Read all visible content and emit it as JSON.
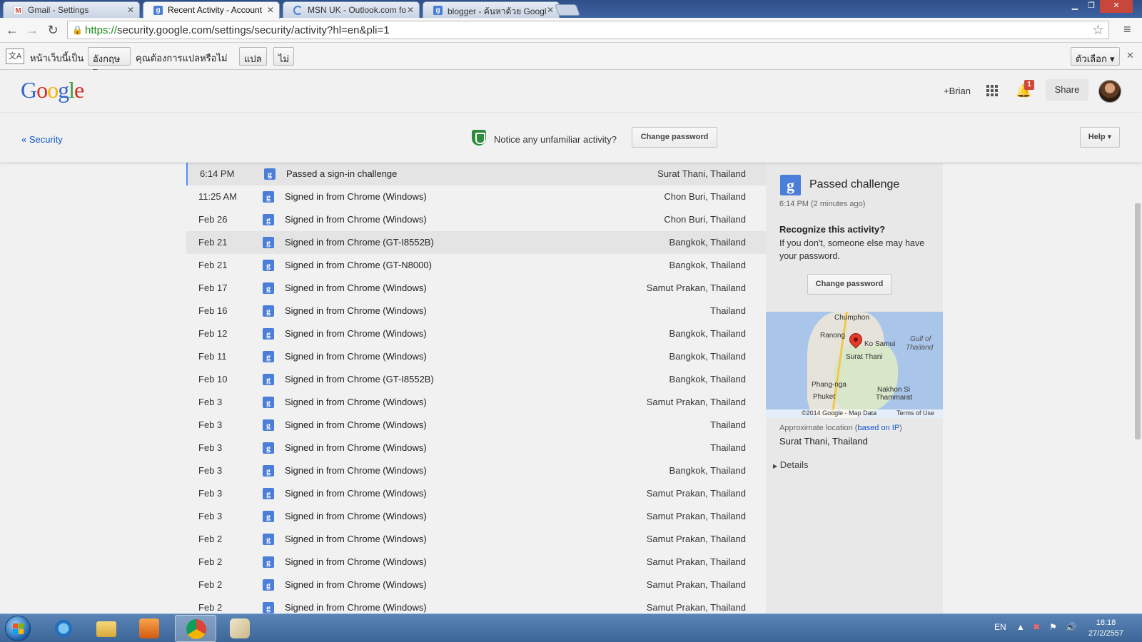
{
  "browser": {
    "tabs": [
      {
        "title": "Gmail - Settings",
        "icon": "gmail-icon",
        "active": false
      },
      {
        "title": "Recent Activity - Account",
        "icon": "google-account-icon",
        "active": true
      },
      {
        "title": "MSN UK - Outlook.com fo",
        "icon": "loading-icon",
        "active": false
      },
      {
        "title": "blogger - ค้นหาด้วย Googl",
        "icon": "google-search-icon",
        "active": false
      }
    ],
    "url_scheme": "https://",
    "url_rest": "security.google.com/settings/security/activity?hl=en&pli=1"
  },
  "translate_bar": {
    "page_is": "หน้าเว็บนี้เป็น",
    "language": "อังกฤษ",
    "question": "คุณต้องการแปลหรือไม่",
    "translate_label": "แปล",
    "no_label": "ไม่",
    "options_label": "ตัวเลือก"
  },
  "header": {
    "logo_letters": [
      "G",
      "o",
      "o",
      "g",
      "l",
      "e"
    ],
    "logo_colors": [
      "#3366cc",
      "#d62d20",
      "#f4b400",
      "#3366cc",
      "#3e9c35",
      "#d62d20"
    ],
    "user_label": "+Brian",
    "notification_count": "1",
    "share_label": "Share"
  },
  "subbar": {
    "back_label": "« Security",
    "notice": "Notice any unfamiliar activity?",
    "change_password_label": "Change password",
    "help_label": "Help"
  },
  "activity": [
    {
      "date": "6:14 PM",
      "desc": "Passed a sign-in challenge",
      "loc": "Surat Thani, Thailand",
      "state": "sel"
    },
    {
      "date": "11:25 AM",
      "desc": "Signed in from Chrome (Windows)",
      "loc": "Chon Buri, Thailand",
      "state": ""
    },
    {
      "date": "Feb 26",
      "desc": "Signed in from Chrome (Windows)",
      "loc": "Chon Buri, Thailand",
      "state": ""
    },
    {
      "date": "Feb 21",
      "desc": "Signed in from Chrome (GT-I8552B)",
      "loc": "Bangkok, Thailand",
      "state": "hover"
    },
    {
      "date": "Feb 21",
      "desc": "Signed in from Chrome (GT-N8000)",
      "loc": "Bangkok, Thailand",
      "state": ""
    },
    {
      "date": "Feb 17",
      "desc": "Signed in from Chrome (Windows)",
      "loc": "Samut Prakan, Thailand",
      "state": ""
    },
    {
      "date": "Feb 16",
      "desc": "Signed in from Chrome (Windows)",
      "loc": "Thailand",
      "state": ""
    },
    {
      "date": "Feb 12",
      "desc": "Signed in from Chrome (Windows)",
      "loc": "Bangkok, Thailand",
      "state": ""
    },
    {
      "date": "Feb 11",
      "desc": "Signed in from Chrome (Windows)",
      "loc": "Bangkok, Thailand",
      "state": ""
    },
    {
      "date": "Feb 10",
      "desc": "Signed in from Chrome (GT-I8552B)",
      "loc": "Bangkok, Thailand",
      "state": ""
    },
    {
      "date": "Feb 3",
      "desc": "Signed in from Chrome (Windows)",
      "loc": "Samut Prakan, Thailand",
      "state": ""
    },
    {
      "date": "Feb 3",
      "desc": "Signed in from Chrome (Windows)",
      "loc": "Thailand",
      "state": ""
    },
    {
      "date": "Feb 3",
      "desc": "Signed in from Chrome (Windows)",
      "loc": "Thailand",
      "state": ""
    },
    {
      "date": "Feb 3",
      "desc": "Signed in from Chrome (Windows)",
      "loc": "Bangkok, Thailand",
      "state": ""
    },
    {
      "date": "Feb 3",
      "desc": "Signed in from Chrome (Windows)",
      "loc": "Samut Prakan, Thailand",
      "state": ""
    },
    {
      "date": "Feb 3",
      "desc": "Signed in from Chrome (Windows)",
      "loc": "Samut Prakan, Thailand",
      "state": ""
    },
    {
      "date": "Feb 2",
      "desc": "Signed in from Chrome (Windows)",
      "loc": "Samut Prakan, Thailand",
      "state": ""
    },
    {
      "date": "Feb 2",
      "desc": "Signed in from Chrome (Windows)",
      "loc": "Samut Prakan, Thailand",
      "state": ""
    },
    {
      "date": "Feb 2",
      "desc": "Signed in from Chrome (Windows)",
      "loc": "Samut Prakan, Thailand",
      "state": ""
    },
    {
      "date": "Feb 2",
      "desc": "Signed in from Chrome (Windows)",
      "loc": "Samut Prakan, Thailand",
      "state": ""
    }
  ],
  "panel": {
    "title": "Passed challenge",
    "time": "6:14 PM (2 minutes ago)",
    "recognize": "Recognize this activity?",
    "recognize_text": "If you don't, someone else may have your password.",
    "change_password_label": "Change password",
    "map_labels": {
      "chumphon": "Chumphon",
      "ranong": "Ranong",
      "ko_samui": "Ko Samui",
      "gulf1": "Gulf of",
      "gulf2": "Thailand",
      "surat": "Surat Thani",
      "phangnga": "Phang-nga",
      "phuket": "Phuket",
      "nakhon1": "Nakhon Si",
      "nakhon2": "Thammarat",
      "copyright": "©2014 Google - Map Data",
      "terms": "Terms of Use"
    },
    "approx_prefix": "Approximate location (",
    "approx_link": "based on IP",
    "approx_suffix": ")",
    "city": "Surat Thani, Thailand",
    "details_label": "Details"
  },
  "taskbar": {
    "lang": "EN",
    "time": "18:18",
    "date": "27/2/2557"
  }
}
